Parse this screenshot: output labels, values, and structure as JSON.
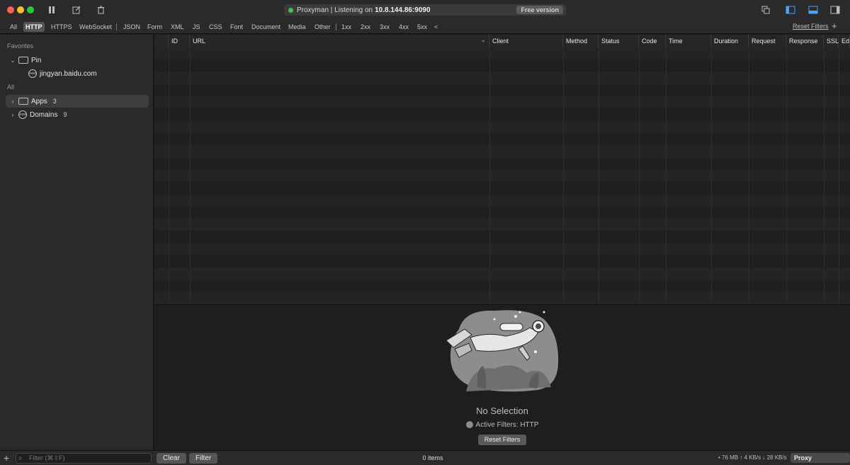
{
  "title_bar": {
    "status_text": "Proxyman | Listening on",
    "status_address": "10.8.144.86:9090",
    "badge": "Free version",
    "icons": [
      "pause-icon",
      "compose-icon",
      "trash-icon",
      "window-icon",
      "left-sidebar-icon",
      "bottom-panel-icon",
      "right-sidebar-icon"
    ]
  },
  "filter_bar": {
    "tabs": [
      "All",
      "HTTP",
      "HTTPS",
      "WebSocket",
      "JSON",
      "Form",
      "XML",
      "JS",
      "CSS",
      "Font",
      "Document",
      "Media",
      "Other",
      "1xx",
      "2xx",
      "3xx",
      "4xx",
      "5xx"
    ],
    "selected": "HTTP",
    "collapse": "<",
    "reset_link": "Reset Filters",
    "add": "+"
  },
  "sidebar": {
    "favorites_header": "Favorites",
    "pin_label": "Pin",
    "pin_item": "jingyan.baidu.com",
    "all_header": "All",
    "apps_label": "Apps",
    "apps_count": "3",
    "domains_label": "Domains",
    "domains_count": "9"
  },
  "table": {
    "columns": [
      "ID",
      "URL",
      "Client",
      "Method",
      "Status",
      "Code",
      "Time",
      "Duration",
      "Request",
      "Response",
      "SSL",
      "Edi"
    ],
    "url_sort_indicator": "⌄"
  },
  "detail": {
    "no_selection": "No Selection",
    "active_filters": "Active Filters: HTTP",
    "reset_button": "Reset Filters"
  },
  "bottom_bar": {
    "add": "+",
    "filter_placeholder": "Filter (⌘⇧F)",
    "clear_button": "Clear",
    "filter_button": "Filter",
    "items": "0 items",
    "stats": "• 76 MB ↑ 4 KB/s ↓ 28 KB/s",
    "proxy_badge": "Proxy Overridden"
  },
  "colors": {
    "background": "#1e1e1e",
    "panel": "#2a2a2a",
    "status_dot": "#3ec44e",
    "traffic_red": "#fe5f57",
    "traffic_yellow": "#febc2e",
    "traffic_green": "#28c840"
  }
}
